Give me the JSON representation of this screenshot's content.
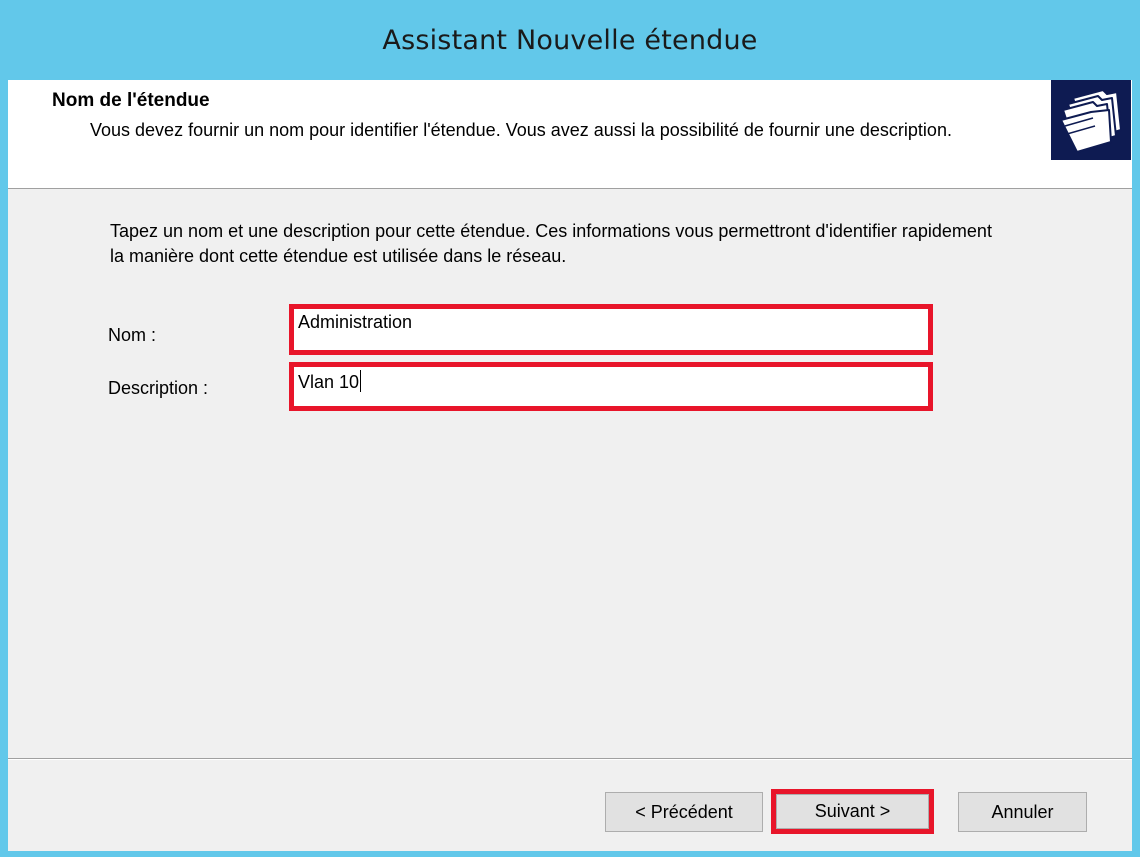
{
  "window": {
    "title": "Assistant Nouvelle étendue"
  },
  "header": {
    "title": "Nom de l'étendue",
    "description": "Vous devez fournir un nom pour identifier l'étendue. Vous avez aussi la possibilité de fournir une description.",
    "icon": "folders-icon"
  },
  "main": {
    "intro": "Tapez un nom et une description pour cette étendue. Ces informations vous permettront d'identifier rapidement la manière dont cette étendue est utilisée dans le réseau.",
    "fields": [
      {
        "label": "Nom :",
        "value": "Administration"
      },
      {
        "label": "Description :",
        "value": "Vlan 10"
      }
    ]
  },
  "footer": {
    "back_label": "< Précédent",
    "next_label": "Suivant >",
    "cancel_label": "Annuler"
  },
  "colors": {
    "title_bar": "#62c8ea",
    "highlight": "#e8152a",
    "icon_bg": "#0e1b52"
  }
}
